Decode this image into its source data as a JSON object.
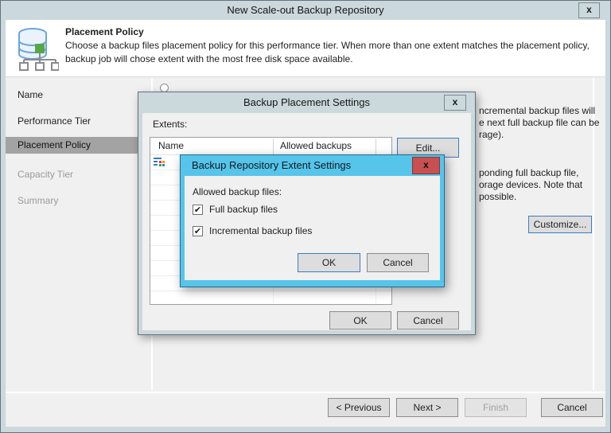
{
  "window": {
    "title": "New Scale-out Backup Repository"
  },
  "icons": {
    "close": "x",
    "check": "✔"
  },
  "banner": {
    "title": "Placement Policy",
    "line1": "Choose a backup files placement policy for this performance tier. When more than one extent matches the placement policy,",
    "line2": "backup job will chose extent with the most free disk space available."
  },
  "sidebar": {
    "items": [
      {
        "label": "Name",
        "state": "done"
      },
      {
        "label": "Performance Tier",
        "state": "done"
      },
      {
        "label": "Placement Policy",
        "state": "active"
      },
      {
        "label": "Capacity Tier",
        "state": "upcoming"
      },
      {
        "label": "Summary",
        "state": "upcoming"
      }
    ]
  },
  "content": {
    "fragments_top": [
      "ncremental backup files will",
      "e next full backup file can be",
      "rage)."
    ],
    "fragments_bottom": [
      "ponding full backup file,",
      "orage devices. Note that",
      "possible."
    ],
    "customize": "Customize..."
  },
  "footer": {
    "previous": "< Previous",
    "next": "Next >",
    "finish": "Finish",
    "cancel": "Cancel"
  },
  "placement_dialog": {
    "title": "Backup Placement Settings",
    "extents_label": "Extents:",
    "columns": [
      "Name",
      "Allowed backups"
    ],
    "edit": "Edit...",
    "ok": "OK",
    "cancel": "Cancel"
  },
  "extent_dialog": {
    "title": "Backup Repository Extent Settings",
    "allowed_label": "Allowed backup files:",
    "checkboxes": [
      {
        "label": "Full backup files",
        "checked": true
      },
      {
        "label": "Incremental backup files",
        "checked": true
      }
    ],
    "ok": "OK",
    "cancel": "Cancel"
  },
  "colors": {
    "chrome": "#cbd8dc",
    "active_title_blue": "#57c4ea",
    "close_red": "#c75050",
    "nav_highlight": "#a3a3a3",
    "focus_border": "#3b7dbf"
  }
}
